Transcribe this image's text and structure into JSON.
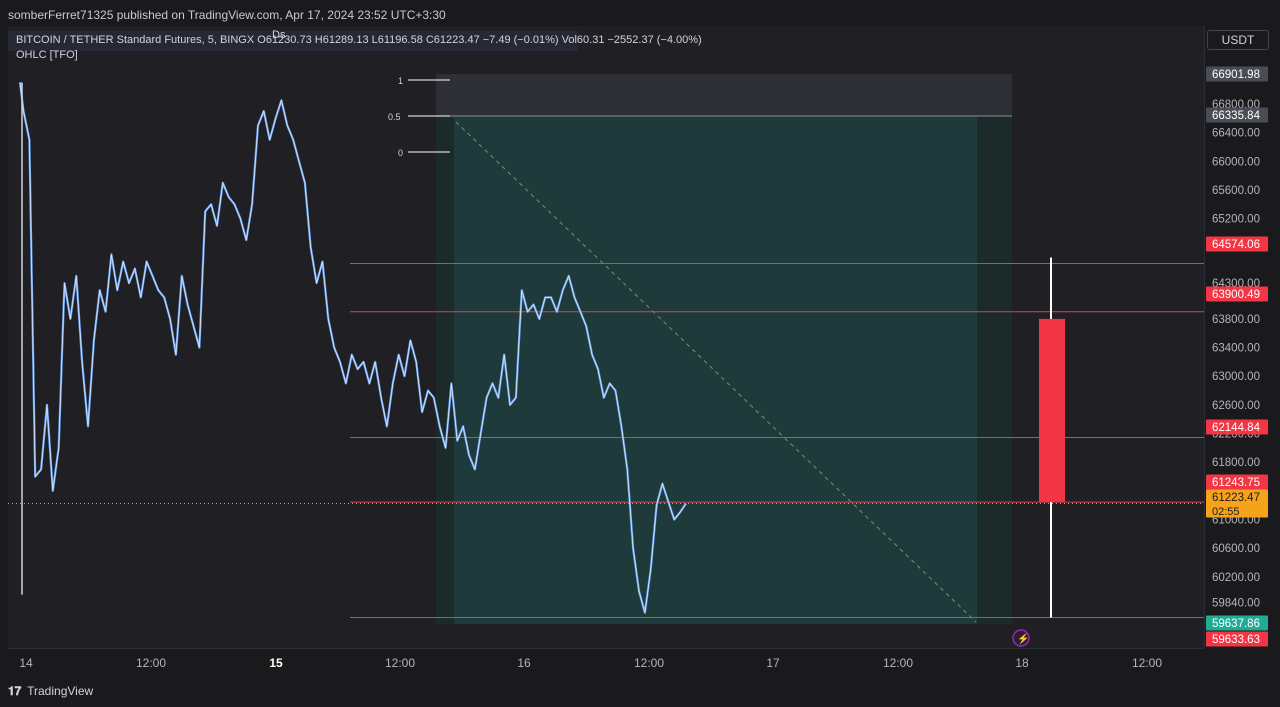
{
  "publish_line": "somberFerret71325 published on TradingView.com, Apr 17, 2024 23:52 UTC+3:30",
  "legend": {
    "symbol_line": "BITCOIN / TETHER Standard Futures, 5, BINGX  O61230.73  H61289.13  L61196.58  C61223.47  −7.49 (−0.01%)  Vol60.31  −2552.37 (−4.00%)",
    "indicator": "OHLC [TFO]",
    "marker": "Ds"
  },
  "currency_button": "USDT",
  "brand": "TradingView",
  "colors": {
    "background": "#1f1f24",
    "candles": "#6aa1ea",
    "zone": "#1f3a3a",
    "level_line": "#d9434f",
    "bar_red": "#f23645",
    "current_price": "#f7a21b",
    "target_green": "#22ab94",
    "icon_purple": "#9c27b0"
  },
  "fib_labels": [
    "1",
    "0.5",
    "0"
  ],
  "chart_data": {
    "type": "line",
    "title": "BITCOIN / TETHER Standard Futures, 5, BINGX",
    "xlabel": "",
    "ylabel": "",
    "ylim": [
      59400,
      67200
    ],
    "x_ticks": [
      "14",
      "12:00",
      "15",
      "12:00",
      "16",
      "12:00",
      "17",
      "12:00",
      "18",
      "12:00"
    ],
    "y_ticks": [
      59840,
      60200,
      60600,
      61000,
      61400,
      61800,
      62200,
      62600,
      63000,
      63400,
      63800,
      64300,
      64800,
      65200,
      65600,
      66000,
      66400,
      66800
    ],
    "price_labels": [
      {
        "value": "66901.98",
        "kind": "box"
      },
      {
        "value": "66335.84",
        "kind": "box"
      },
      {
        "value": "64574.06",
        "kind": "level"
      },
      {
        "value": "63900.49",
        "kind": "level"
      },
      {
        "value": "62144.84",
        "kind": "level"
      },
      {
        "value": "61243.75",
        "kind": "level"
      },
      {
        "value": "61223.47",
        "kind": "current"
      },
      {
        "value": "59637.86",
        "kind": "target"
      },
      {
        "value": "59633.63",
        "kind": "level"
      }
    ],
    "countdown": "02:55",
    "horizontal_levels": [
      64574.06,
      63900.49,
      62144.84,
      61243.75,
      59633.63
    ],
    "price_series": {
      "name": "",
      "x": [
        0,
        0.3,
        0.8,
        1.3,
        1.8,
        2.3,
        2.8,
        3.3,
        3.8,
        4.3,
        4.8,
        5.3,
        5.8,
        6.3,
        6.8,
        7.3,
        7.8,
        8.3,
        8.8,
        9.3,
        9.8,
        10.3,
        10.8,
        11.3,
        11.8,
        12.3,
        12.8,
        13.3,
        13.8,
        14.3,
        14.8,
        15.3,
        15.8,
        16.3,
        16.8,
        17.3,
        17.8,
        18.3,
        18.8,
        19.3,
        19.8,
        20.3,
        20.8,
        21.3,
        21.8,
        22.3,
        22.8,
        23.3,
        23.8,
        24.3,
        24.8,
        25.3,
        25.8,
        26.3,
        26.8,
        27.3,
        27.8,
        28.3,
        28.8,
        29.3,
        29.8,
        30.3,
        30.8,
        31.3,
        31.8,
        32.3,
        32.8,
        33.3,
        33.8,
        34.3,
        34.8,
        35.3,
        35.8,
        36.3,
        36.8,
        37.3,
        37.8,
        38.3,
        38.8,
        39.3,
        39.8,
        40.3,
        40.8,
        41.3,
        41.8,
        42.3,
        42.8,
        43.3,
        43.8,
        44.3,
        44.8,
        45.3,
        45.8,
        46.3,
        46.8,
        47.3,
        47.8,
        48.3,
        48.8,
        49.3,
        49.8,
        50.3,
        50.8,
        51.3,
        51.8,
        52.3,
        52.8,
        53.3,
        53.8,
        54.3,
        54.8,
        55.3,
        55.8,
        56.3,
        56.8,
        57.3,
        57.8,
        58.3,
        58.8,
        59.3,
        59.8,
        60.3,
        60.8,
        61.3,
        61.8,
        62.3,
        62.8,
        63.3,
        63.8,
        64.3,
        64.8,
        65.3,
        65.8,
        66.3,
        66.8,
        67.3,
        67.8,
        68.3,
        68.8,
        69.3,
        69.8,
        70.3,
        70.8,
        71.3,
        71.8,
        72.3,
        72.8,
        73.3,
        73.8,
        74.3,
        74.8,
        75.3,
        75.8,
        76.3,
        76.8,
        77.3,
        77.8,
        78.3,
        78.8,
        79.3,
        79.8,
        80.3,
        80.8,
        81.3,
        81.8,
        82.3,
        82.8,
        83.3,
        83.8,
        84.3,
        84.8,
        85.3
      ],
      "y": [
        67100,
        66700,
        66300,
        61600,
        61700,
        62600,
        61400,
        62000,
        64300,
        63800,
        64400,
        63200,
        62300,
        63500,
        64200,
        63900,
        64700,
        64200,
        64600,
        64300,
        64500,
        64100,
        64600,
        64400,
        64200,
        64100,
        63800,
        63300,
        64400,
        64000,
        63700,
        63400,
        65300,
        65400,
        65100,
        65700,
        65500,
        65400,
        65200,
        64900,
        65400,
        66500,
        66700,
        66300,
        66600,
        66850,
        66500,
        66300,
        66000,
        65700,
        64800,
        64300,
        64600,
        63800,
        63400,
        63200,
        62900,
        63300,
        63100,
        63200,
        62900,
        63200,
        62700,
        62300,
        62900,
        63300,
        63000,
        63500,
        63200,
        62500,
        62800,
        62700,
        62300,
        62000,
        62900,
        62100,
        62300,
        61900,
        61700,
        62200,
        62700,
        62900,
        62700,
        63300,
        62600,
        62700,
        64200,
        63900,
        64000,
        63800,
        64100,
        64100,
        63900,
        64200,
        64400,
        64100,
        63900,
        63700,
        63300,
        63100,
        62700,
        62900,
        62800,
        62300,
        61700,
        60600,
        60000,
        59700,
        60300,
        61200,
        61500,
        61250,
        61000,
        61100,
        61223
      ],
      "x_range_note": ""
    }
  }
}
